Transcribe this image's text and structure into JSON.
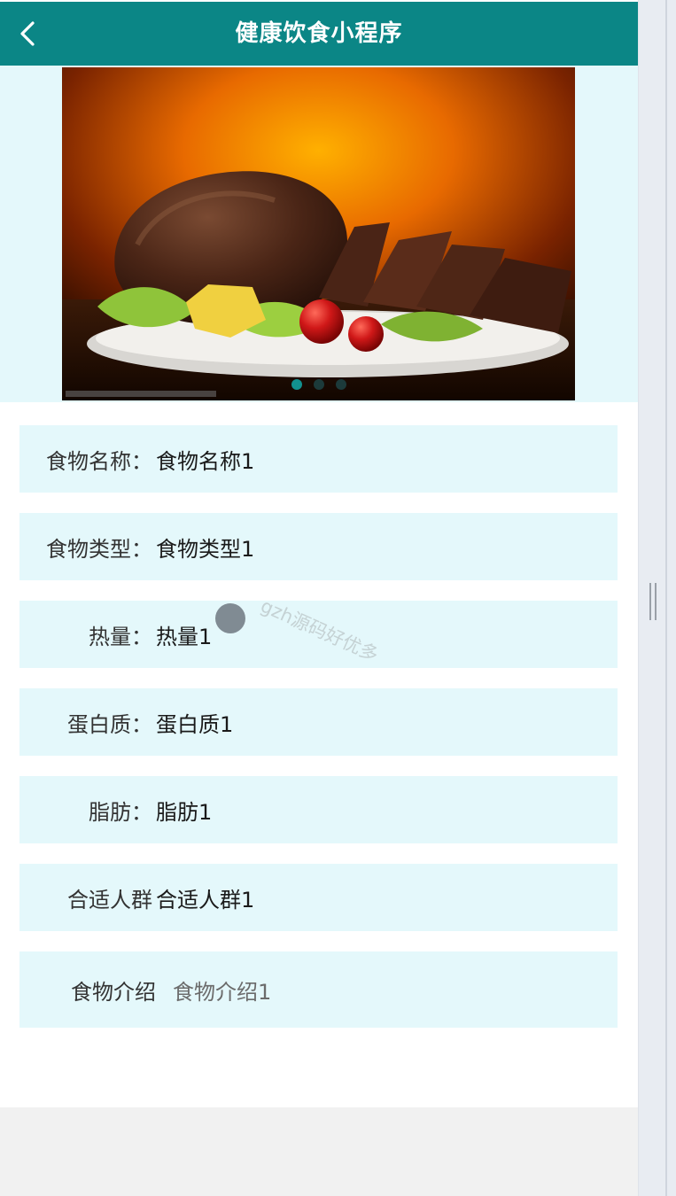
{
  "header": {
    "title": "健康饮食小程序",
    "back_icon": "chevron-left-icon"
  },
  "banner": {
    "image": "roast-meat-on-plate",
    "slide_count": 3,
    "active_index": 0
  },
  "details": [
    {
      "label": "食物名称：",
      "value": "食物名称1"
    },
    {
      "label": "食物类型：",
      "value": "食物类型1"
    },
    {
      "label": "热量：",
      "value": "热量1"
    },
    {
      "label": "蛋白质：",
      "value": "蛋白质1"
    },
    {
      "label": "脂肪：",
      "value": "脂肪1"
    },
    {
      "label": "合适人群",
      "value": "合适人群1"
    },
    {
      "label": "食物介绍",
      "value": "食物介绍1"
    }
  ],
  "overlay": {
    "watermark": "gzh源码好优多"
  },
  "colors": {
    "nav": "#0b8686",
    "row_bg": "#e4f8fb",
    "dot_active": "#12908f"
  }
}
